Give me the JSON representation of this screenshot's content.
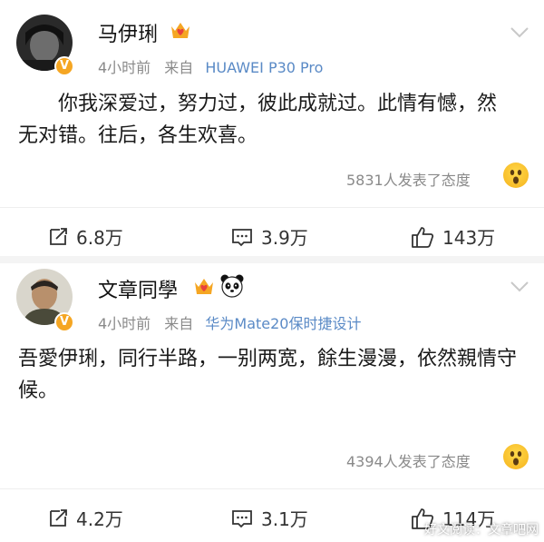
{
  "colors": {
    "link_blue": "#5a8ac6",
    "meta_gray": "#8a8a8a",
    "verified_orange": "#f5a623",
    "divider": "#eeeeee"
  },
  "posts": [
    {
      "username": "马伊琍",
      "badges": [
        "crown-heart-icon"
      ],
      "time": "4小时前",
      "from_label": "来自",
      "source": "HUAWEI P30 Pro",
      "content": "你我深爱过，努力过，彼此成就过。此情有憾，然无对错。往后，各生欢喜。",
      "reaction_text": "5831人发表了态度",
      "repost_count": "6.8万",
      "comment_count": "3.9万",
      "like_count": "143万"
    },
    {
      "username": "文章同學",
      "badges": [
        "crown-heart-icon",
        "panda-icon"
      ],
      "time": "4小时前",
      "from_label": "来自",
      "source": "华为Mate20保时捷设计",
      "content": "吾愛伊琍，同行半路，一别两宽，餘生漫漫，依然親情守候。",
      "reaction_text": "4394人发表了态度",
      "repost_count": "4.2万",
      "comment_count": "3.1万",
      "like_count": "114万"
    }
  ],
  "watermark": "好文阅读：文章吧网"
}
